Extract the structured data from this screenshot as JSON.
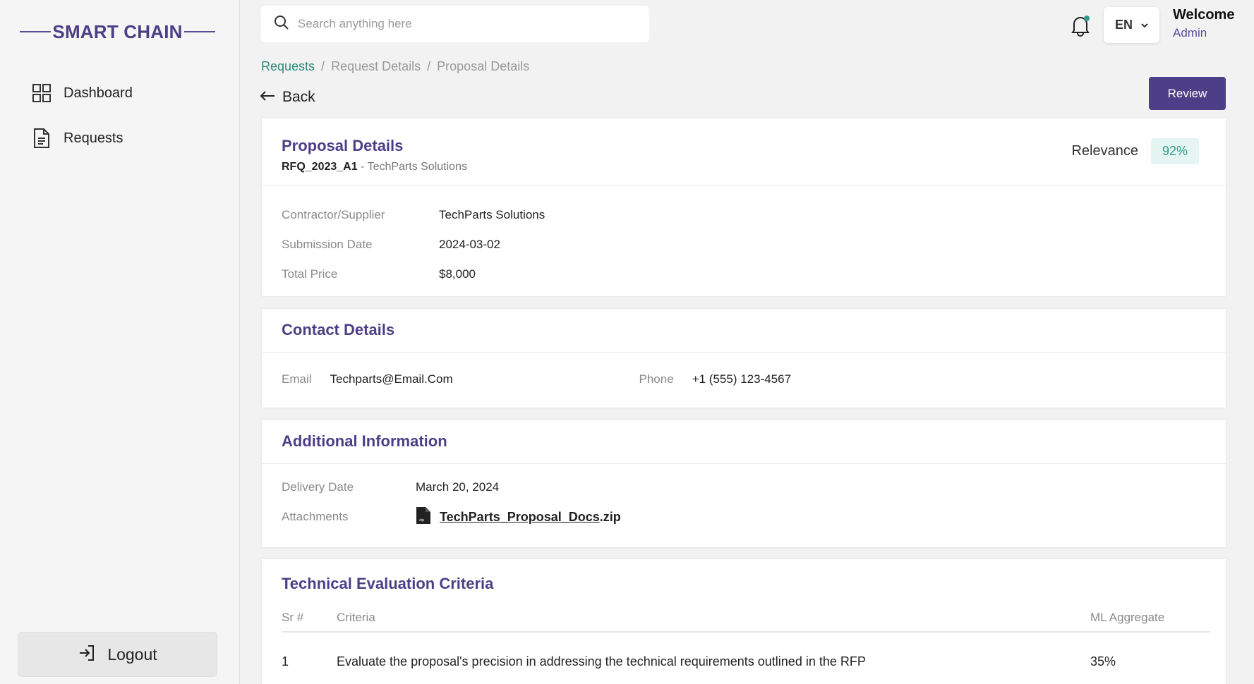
{
  "brand": {
    "name": "SMART CHAIN"
  },
  "sidebar": {
    "items": [
      {
        "label": "Dashboard",
        "icon": "grid-icon"
      },
      {
        "label": "Requests",
        "icon": "document-icon"
      }
    ],
    "logout_label": "Logout"
  },
  "header": {
    "search_placeholder": "Search anything here",
    "language": "EN",
    "welcome": "Welcome",
    "user": "Admin"
  },
  "breadcrumb": [
    "Requests",
    "Request Details",
    "Proposal Details"
  ],
  "back_label": "Back",
  "review_label": "Review",
  "proposal": {
    "title": "Proposal Details",
    "rfq_id": "RFQ_2023_A1",
    "separator": " - ",
    "supplier_sub": "TechParts Solutions",
    "relevance_label": "Relevance",
    "relevance_value": "92%",
    "fields": [
      {
        "label": "Contractor/Supplier",
        "value": "TechParts Solutions"
      },
      {
        "label": "Submission Date",
        "value": "2024-03-02"
      },
      {
        "label": "Total Price",
        "value": "$8,000"
      }
    ]
  },
  "contact": {
    "title": "Contact Details",
    "email_label": "Email",
    "email": "Techparts@Email.Com",
    "phone_label": "Phone",
    "phone": "+1 (555) 123-4567"
  },
  "additional": {
    "title": "Additional Information",
    "delivery_label": "Delivery Date",
    "delivery_value": "March 20, 2024",
    "attachments_label": "Attachments",
    "attachment_name": "TechParts_Proposal_Docs",
    "attachment_ext": ".zip"
  },
  "criteria": {
    "title": "Technical Evaluation Criteria",
    "columns": [
      "Sr #",
      "Criteria",
      "ML Aggregate"
    ],
    "rows": [
      {
        "sr": "1",
        "criteria": "Evaluate the proposal's precision in addressing the technical requirements outlined in the RFP",
        "aggregate": "35%"
      }
    ]
  },
  "colors": {
    "brand": "#4d3f87",
    "accent": "#2d8a7e",
    "badge_bg": "#e6f5f2"
  }
}
